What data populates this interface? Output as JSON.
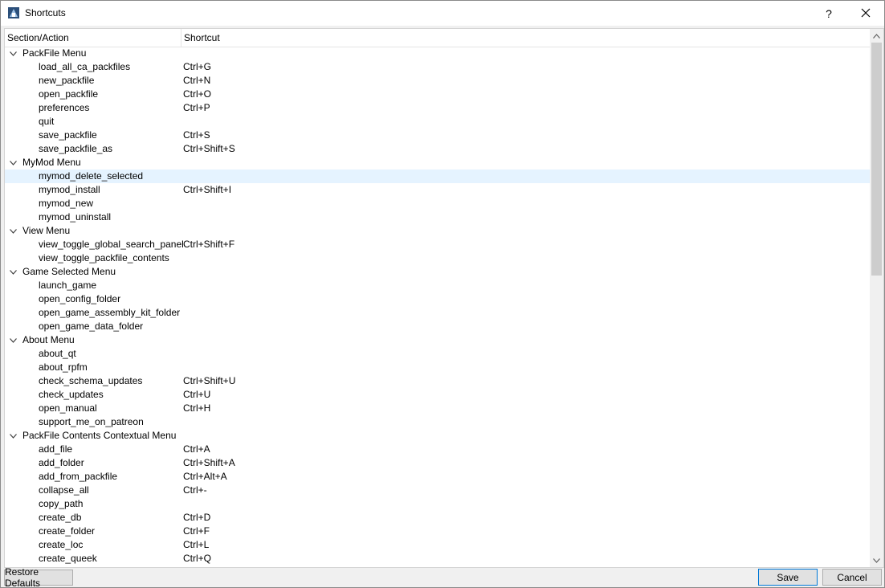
{
  "window": {
    "title": "Shortcuts",
    "help_label": "?",
    "close_label": "✕"
  },
  "columns": {
    "action": "Section/Action",
    "shortcut": "Shortcut"
  },
  "rows": [
    {
      "kind": "section",
      "label": "PackFile Menu",
      "shortcut": ""
    },
    {
      "kind": "action",
      "label": "load_all_ca_packfiles",
      "shortcut": "Ctrl+G"
    },
    {
      "kind": "action",
      "label": "new_packfile",
      "shortcut": "Ctrl+N"
    },
    {
      "kind": "action",
      "label": "open_packfile",
      "shortcut": "Ctrl+O"
    },
    {
      "kind": "action",
      "label": "preferences",
      "shortcut": "Ctrl+P"
    },
    {
      "kind": "action",
      "label": "quit",
      "shortcut": ""
    },
    {
      "kind": "action",
      "label": "save_packfile",
      "shortcut": "Ctrl+S"
    },
    {
      "kind": "action",
      "label": "save_packfile_as",
      "shortcut": "Ctrl+Shift+S"
    },
    {
      "kind": "section",
      "label": "MyMod Menu",
      "shortcut": ""
    },
    {
      "kind": "action",
      "label": "mymod_delete_selected",
      "shortcut": "",
      "selected": true
    },
    {
      "kind": "action",
      "label": "mymod_install",
      "shortcut": "Ctrl+Shift+I"
    },
    {
      "kind": "action",
      "label": "mymod_new",
      "shortcut": ""
    },
    {
      "kind": "action",
      "label": "mymod_uninstall",
      "shortcut": ""
    },
    {
      "kind": "section",
      "label": "View Menu",
      "shortcut": ""
    },
    {
      "kind": "action",
      "label": "view_toggle_global_search_panel",
      "shortcut": "Ctrl+Shift+F"
    },
    {
      "kind": "action",
      "label": "view_toggle_packfile_contents",
      "shortcut": ""
    },
    {
      "kind": "section",
      "label": "Game Selected Menu",
      "shortcut": ""
    },
    {
      "kind": "action",
      "label": "launch_game",
      "shortcut": ""
    },
    {
      "kind": "action",
      "label": "open_config_folder",
      "shortcut": ""
    },
    {
      "kind": "action",
      "label": "open_game_assembly_kit_folder",
      "shortcut": ""
    },
    {
      "kind": "action",
      "label": "open_game_data_folder",
      "shortcut": ""
    },
    {
      "kind": "section",
      "label": "About Menu",
      "shortcut": ""
    },
    {
      "kind": "action",
      "label": "about_qt",
      "shortcut": ""
    },
    {
      "kind": "action",
      "label": "about_rpfm",
      "shortcut": ""
    },
    {
      "kind": "action",
      "label": "check_schema_updates",
      "shortcut": "Ctrl+Shift+U"
    },
    {
      "kind": "action",
      "label": "check_updates",
      "shortcut": "Ctrl+U"
    },
    {
      "kind": "action",
      "label": "open_manual",
      "shortcut": "Ctrl+H"
    },
    {
      "kind": "action",
      "label": "support_me_on_patreon",
      "shortcut": ""
    },
    {
      "kind": "section",
      "label": "PackFile Contents Contextual Menu",
      "shortcut": ""
    },
    {
      "kind": "action",
      "label": "add_file",
      "shortcut": "Ctrl+A"
    },
    {
      "kind": "action",
      "label": "add_folder",
      "shortcut": "Ctrl+Shift+A"
    },
    {
      "kind": "action",
      "label": "add_from_packfile",
      "shortcut": "Ctrl+Alt+A"
    },
    {
      "kind": "action",
      "label": "collapse_all",
      "shortcut": "Ctrl+-"
    },
    {
      "kind": "action",
      "label": "copy_path",
      "shortcut": ""
    },
    {
      "kind": "action",
      "label": "create_db",
      "shortcut": "Ctrl+D"
    },
    {
      "kind": "action",
      "label": "create_folder",
      "shortcut": "Ctrl+F"
    },
    {
      "kind": "action",
      "label": "create_loc",
      "shortcut": "Ctrl+L"
    },
    {
      "kind": "action",
      "label": "create_queek",
      "shortcut": "Ctrl+Q"
    }
  ],
  "buttons": {
    "restore": "Restore Defaults",
    "save": "Save",
    "cancel": "Cancel"
  },
  "colors": {
    "selection": "#e5f3ff",
    "default_button_border": "#0078d7"
  }
}
